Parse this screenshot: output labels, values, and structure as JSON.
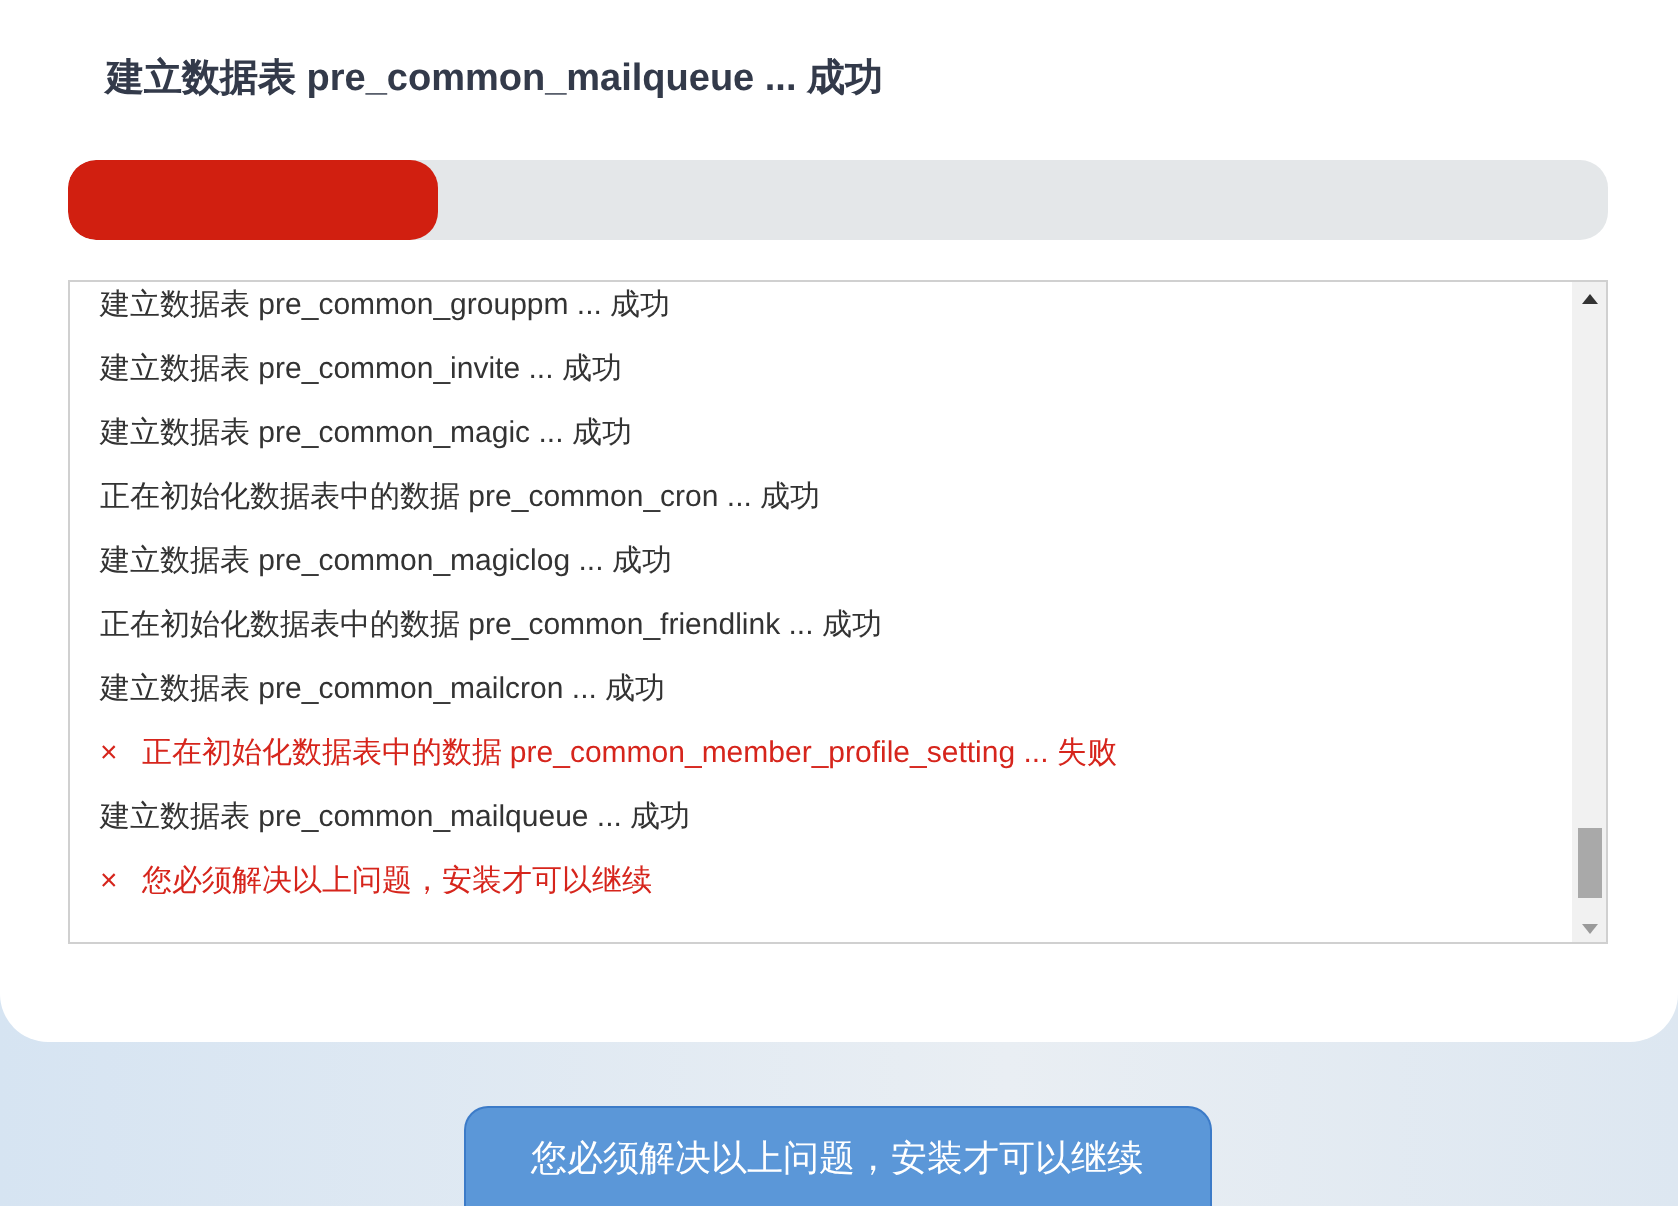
{
  "title": "建立数据表 pre_common_mailqueue ... 成功",
  "progress": {
    "level": 0.24
  },
  "log": [
    {
      "kind": "ok",
      "text": "建立数据表 pre_common_grouppm ... 成功"
    },
    {
      "kind": "ok",
      "text": "建立数据表 pre_common_invite ... 成功"
    },
    {
      "kind": "ok",
      "text": "建立数据表 pre_common_magic ... 成功"
    },
    {
      "kind": "ok",
      "text": "正在初始化数据表中的数据 pre_common_cron ... 成功"
    },
    {
      "kind": "ok",
      "text": "建立数据表 pre_common_magiclog ... 成功"
    },
    {
      "kind": "ok",
      "text": "正在初始化数据表中的数据 pre_common_friendlink ... 成功"
    },
    {
      "kind": "ok",
      "text": "建立数据表 pre_common_mailcron ... 成功"
    },
    {
      "kind": "error",
      "mark": "×",
      "text": "正在初始化数据表中的数据 pre_common_member_profile_setting ... 失败"
    },
    {
      "kind": "ok",
      "text": "建立数据表 pre_common_mailqueue ... 成功"
    },
    {
      "kind": "error",
      "mark": "×",
      "text": "您必须解决以上问题，安装才可以继续"
    }
  ],
  "toast": "您必须解决以上问题，安装才可以继续"
}
